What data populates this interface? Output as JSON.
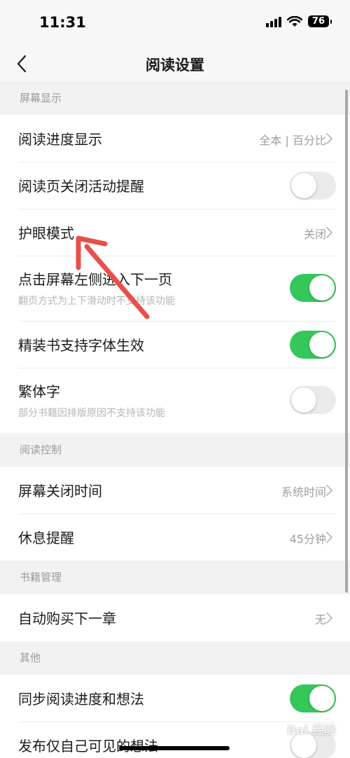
{
  "status_bar": {
    "time": "11:31",
    "battery": "76"
  },
  "nav": {
    "title": "阅读设置"
  },
  "sections": {
    "screen": {
      "header": "屏幕显示",
      "progress_display": {
        "label": "阅读进度显示",
        "value": "全本 | 百分比"
      },
      "close_reminder": {
        "label": "阅读页关闭活动提醒",
        "enabled": false
      },
      "eye_mode": {
        "label": "护眼模式",
        "value": "关闭"
      },
      "tap_left": {
        "label": "点击屏幕左侧进入下一页",
        "sub": "翻页方式为上下滑动时不支持该功能",
        "enabled": true
      },
      "bound_font": {
        "label": "精装书支持字体生效",
        "enabled": true
      },
      "traditional": {
        "label": "繁体字",
        "sub": "部分书籍因排版原因不支持该功能",
        "enabled": false
      }
    },
    "control": {
      "header": "阅读控制",
      "screen_off": {
        "label": "屏幕关闭时间",
        "value": "系统时间"
      },
      "rest_reminder": {
        "label": "休息提醒",
        "value": "45分钟"
      }
    },
    "books": {
      "header": "书籍管理",
      "auto_buy": {
        "label": "自动购买下一章",
        "value": "无"
      }
    },
    "other": {
      "header": "其他",
      "sync_progress": {
        "label": "同步阅读进度和想法",
        "enabled": true
      },
      "private_thoughts": {
        "label": "发布仅自己可见的想法",
        "enabled": false
      }
    }
  },
  "watermark": {
    "text": "Bai 经验"
  },
  "colors": {
    "toggle_on": "#34c759",
    "toggle_off": "#ebebeb",
    "annotation_arrow": "#e8504a"
  }
}
